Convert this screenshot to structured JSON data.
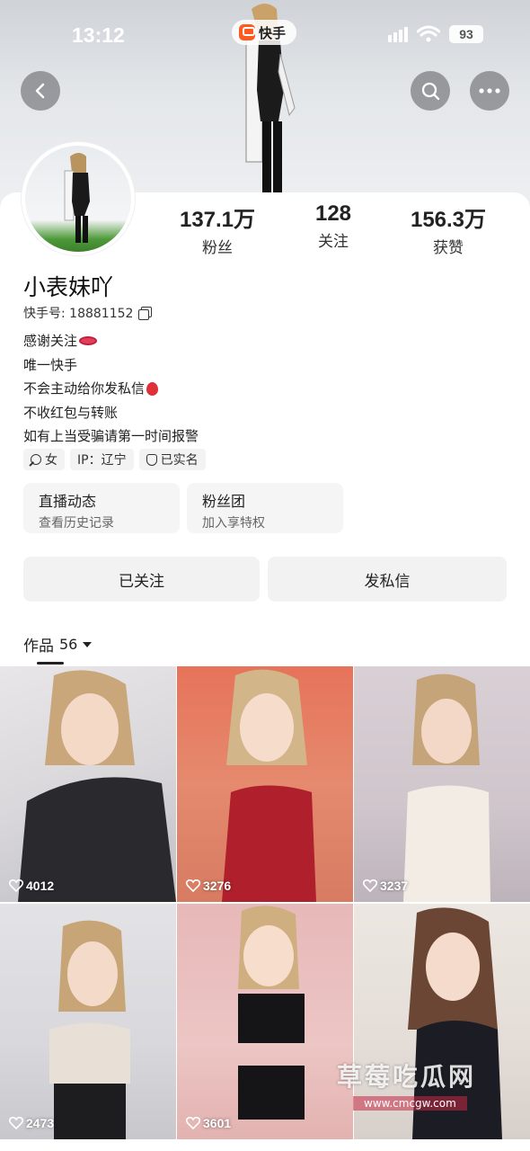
{
  "status_bar": {
    "time": "13:12",
    "app_name": "快手",
    "battery": "93"
  },
  "nav": {
    "back_icon": "chevron-left-icon",
    "search_icon": "search-icon",
    "more_icon": "more-horizontal-icon"
  },
  "profile": {
    "name": "小表妹吖",
    "kuaishou_id": "快手号: 18881152",
    "stats": [
      {
        "value": "137.1万",
        "label": "粉丝"
      },
      {
        "value": "128",
        "label": "关注"
      },
      {
        "value": "156.3万",
        "label": "获赞"
      }
    ],
    "bio_lines": [
      "感谢关注",
      "唯一快手",
      "不会主动给你发私信",
      "不收红包与转账",
      "如有上当受骗请第一时间报警"
    ],
    "tags": {
      "gender": "女",
      "ip": "IP：辽宁",
      "verified": "已实名"
    }
  },
  "features": [
    {
      "title": "直播动态",
      "subtitle": "查看历史记录"
    },
    {
      "title": "粉丝团",
      "subtitle": "加入享特权"
    }
  ],
  "actions": {
    "followed": "已关注",
    "message": "发私信"
  },
  "works": {
    "label": "作品",
    "count": "56",
    "items": [
      {
        "likes": "4012"
      },
      {
        "likes": "3276"
      },
      {
        "likes": "3237"
      },
      {
        "likes": "2473"
      },
      {
        "likes": "3601"
      },
      {
        "likes": ""
      }
    ]
  },
  "watermark": {
    "title": "草莓吃瓜网",
    "url": "www.cmcgw.com"
  },
  "colors": {
    "brand": "#ff5a1f",
    "button_bg": "#f2f2f2"
  }
}
